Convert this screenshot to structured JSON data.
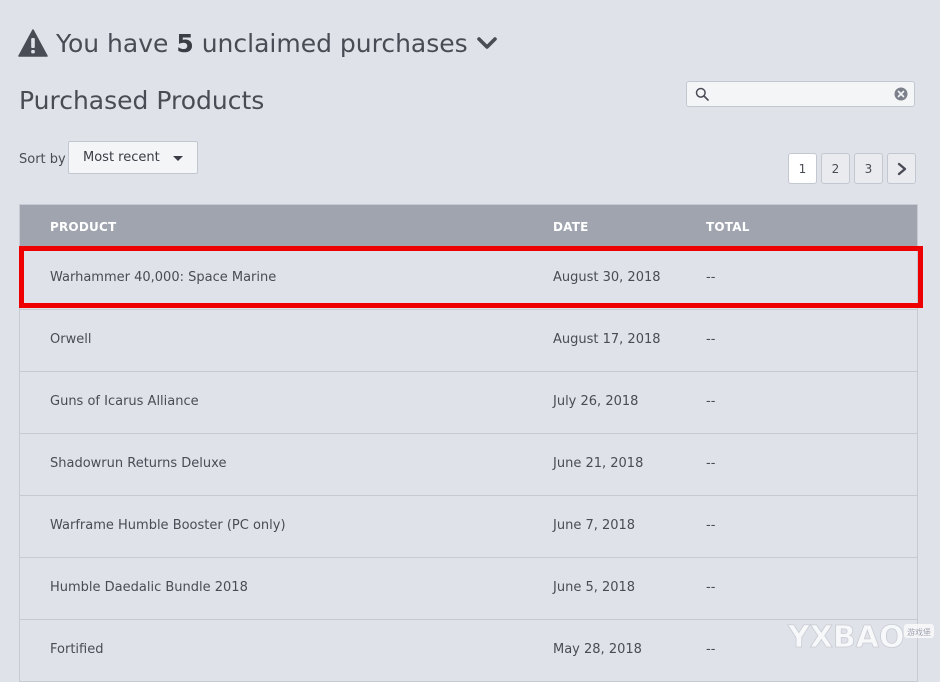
{
  "unclaimed": {
    "prefix": "You have",
    "count": "5",
    "suffix": "unclaimed purchases"
  },
  "page": {
    "title": "Purchased Products"
  },
  "search": {
    "value": "",
    "placeholder": ""
  },
  "sort": {
    "label": "Sort by",
    "selected": "Most recent"
  },
  "pagination": {
    "pages": [
      "1",
      "2",
      "3"
    ],
    "current": "1"
  },
  "table": {
    "headers": {
      "product": "PRODUCT",
      "date": "DATE",
      "total": "TOTAL"
    },
    "rows": [
      {
        "product": "Warhammer 40,000: Space Marine",
        "date": "August 30, 2018",
        "total": "--"
      },
      {
        "product": "Orwell",
        "date": "August 17, 2018",
        "total": "--"
      },
      {
        "product": "Guns of Icarus Alliance",
        "date": "July 26, 2018",
        "total": "--"
      },
      {
        "product": "Shadowrun Returns Deluxe",
        "date": "June 21, 2018",
        "total": "--"
      },
      {
        "product": "Warframe Humble Booster (PC only)",
        "date": "June 7, 2018",
        "total": "--"
      },
      {
        "product": "Humble Daedalic Bundle 2018",
        "date": "June 5, 2018",
        "total": "--"
      },
      {
        "product": "Fortified",
        "date": "May 28, 2018",
        "total": "--"
      }
    ]
  },
  "icons": {
    "warning": "warning-icon",
    "chevron": "chevron-down-icon",
    "search": "search-icon",
    "clear": "clear-icon",
    "next": "chevron-right-icon"
  },
  "colors": {
    "background": "#dfe2e9",
    "header": "#a0a4af",
    "highlight": "#ee0000",
    "text": "#494c55"
  },
  "watermark": {
    "text": "YXBAO",
    "badge": "游戏堡"
  }
}
